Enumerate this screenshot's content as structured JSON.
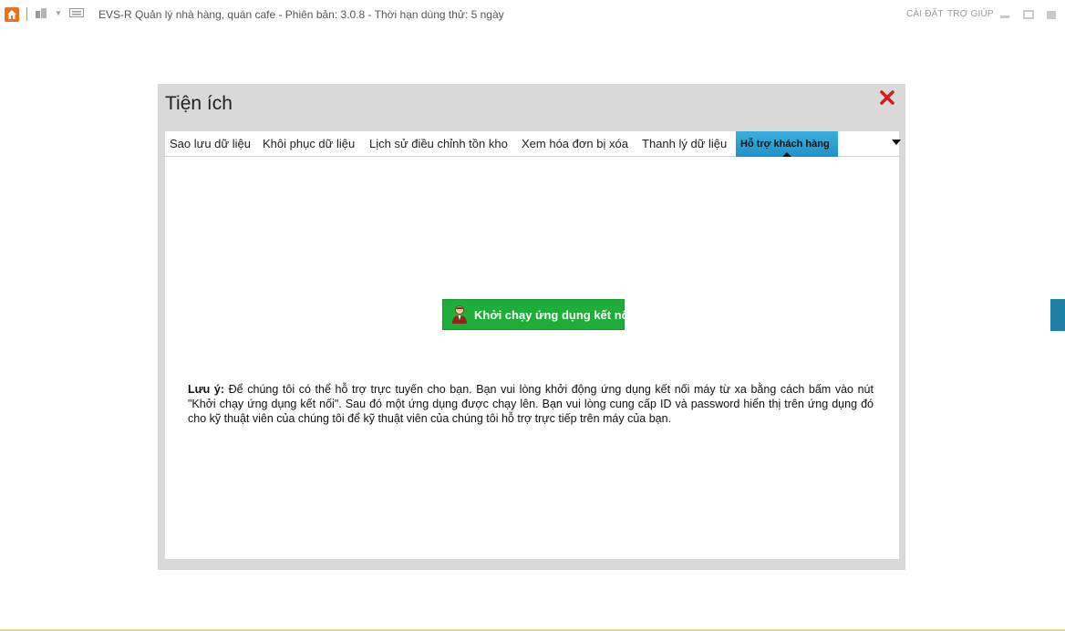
{
  "window": {
    "title": "EVS-R Quản lý nhà hàng, quán cafe - Phiên bản: 3.0.8 - Thời hạn dùng thử: 5 ngày",
    "links": {
      "settings": "CÀI ĐẶT",
      "help": "TRỢ GIÚP"
    },
    "icons": [
      "home-icon",
      "building-icon",
      "dropdown-icon",
      "keyboard-icon",
      "minimize-icon",
      "restore-icon",
      "close-icon"
    ]
  },
  "dialog": {
    "title": "Tiện ích",
    "tabs": [
      {
        "label": "Sao lưu dữ liệu"
      },
      {
        "label": "Khôi phục dữ liệu"
      },
      {
        "label": "Lịch sử điều chỉnh tồn kho"
      },
      {
        "label": "Xem hóa đơn bị xóa"
      },
      {
        "label": "Thanh lý dữ liệu"
      },
      {
        "label": "Hỗ trợ khách hàng"
      }
    ],
    "active_tab": "Hỗ trợ khách hàng",
    "support": {
      "button_label": "Khởi chạy ứng dụng kết nối",
      "note_label": "Lưu ý:",
      "note_text": " Để chúng tôi có thể hỗ trợ trực tuyến cho bạn. Bạn vui lòng khởi động ứng dụng kết nối máy từ xa bằng cách bấm vào nút \"Khởi chạy ứng dụng kết nối\". Sau đó một ứng dụng được chạy lên. Bạn vui lòng cung cấp ID và password hiển thị trên ứng dụng đó cho kỹ thuật viên của chúng tôi để kỹ thuật viên của chúng tôi hỗ trợ trực tiếp trên máy của bạn."
    }
  },
  "colors": {
    "accent": "#1d93c8",
    "button_green": "#1fad3a",
    "close_red": "#d51c1c",
    "home_orange": "#e8731c"
  }
}
